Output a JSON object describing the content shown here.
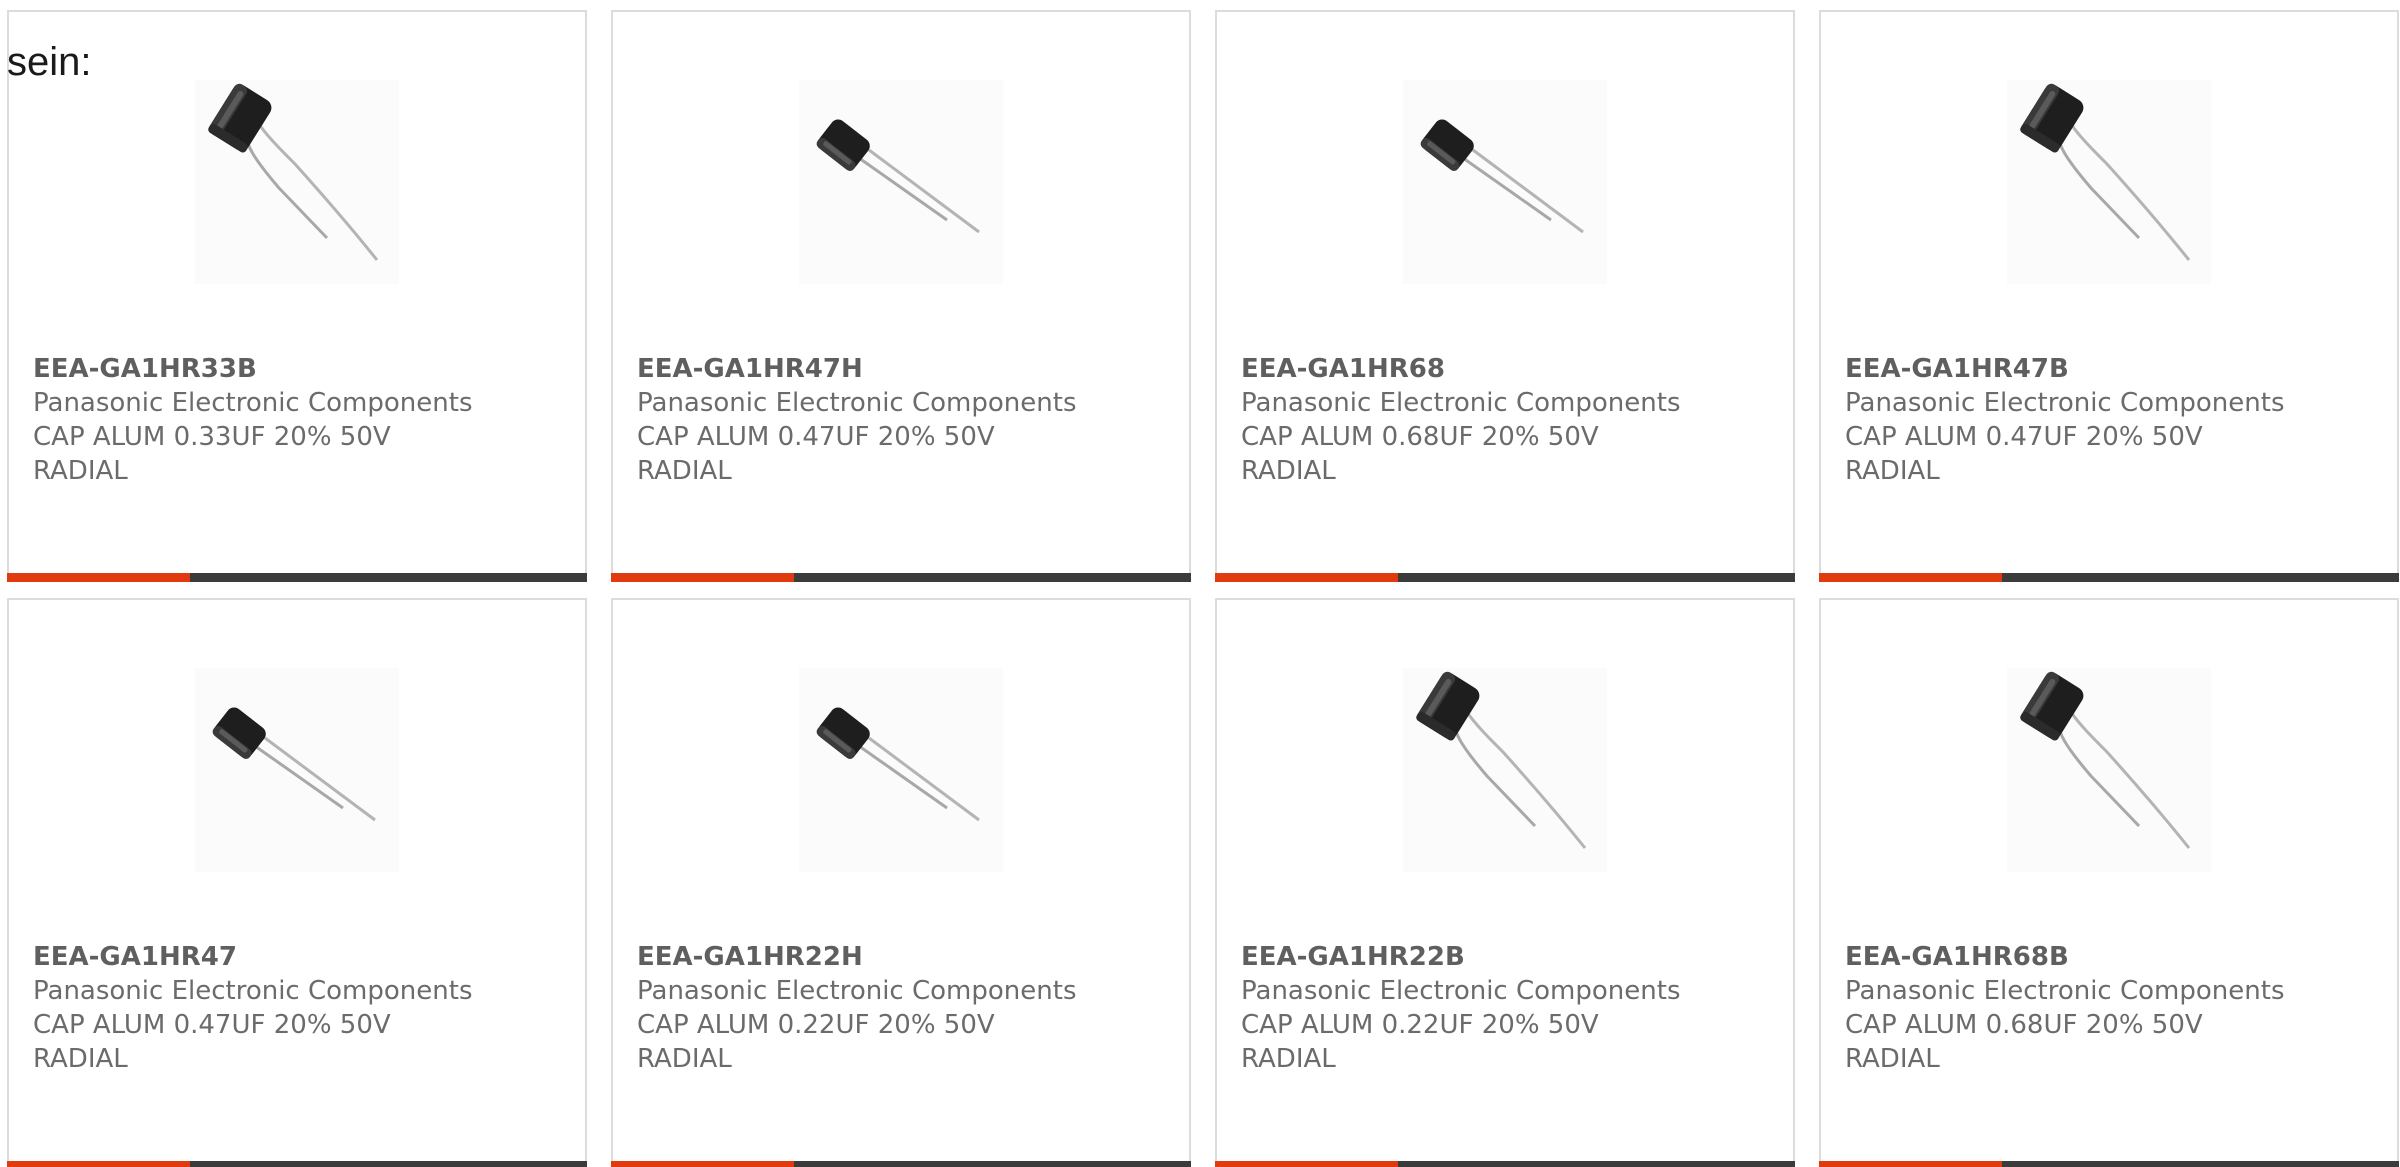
{
  "intro_text": "sein:",
  "colors": {
    "accent": "#e03a0e",
    "bar": "#3b3b3b",
    "border": "#dcdcdc",
    "text": "#6b6b6b"
  },
  "products": [
    {
      "part_number": "EEA-GA1HR33B",
      "manufacturer": "Panasonic Electronic Components",
      "description": "CAP ALUM 0.33UF 20% 50V RADIAL",
      "image_icon": "capacitor-bent-leads-image"
    },
    {
      "part_number": "EEA-GA1HR47H",
      "manufacturer": "Panasonic Electronic Components",
      "description": "CAP ALUM 0.47UF 20% 50V RADIAL",
      "image_icon": "capacitor-straight-leads-image"
    },
    {
      "part_number": "EEA-GA1HR68",
      "manufacturer": "Panasonic Electronic Components",
      "description": "CAP ALUM 0.68UF 20% 50V RADIAL",
      "image_icon": "capacitor-straight-leads-image"
    },
    {
      "part_number": "EEA-GA1HR47B",
      "manufacturer": "Panasonic Electronic Components",
      "description": "CAP ALUM 0.47UF 20% 50V RADIAL",
      "image_icon": "capacitor-bent-leads-image"
    },
    {
      "part_number": "EEA-GA1HR47",
      "manufacturer": "Panasonic Electronic Components",
      "description": "CAP ALUM 0.47UF 20% 50V RADIAL",
      "image_icon": "capacitor-straight-leads-image"
    },
    {
      "part_number": "EEA-GA1HR22H",
      "manufacturer": "Panasonic Electronic Components",
      "description": "CAP ALUM 0.22UF 20% 50V RADIAL",
      "image_icon": "capacitor-straight-leads-image"
    },
    {
      "part_number": "EEA-GA1HR22B",
      "manufacturer": "Panasonic Electronic Components",
      "description": "CAP ALUM 0.22UF 20% 50V RADIAL",
      "image_icon": "capacitor-bent-leads-image"
    },
    {
      "part_number": "EEA-GA1HR68B",
      "manufacturer": "Panasonic Electronic Components",
      "description": "CAP ALUM 0.68UF 20% 50V RADIAL",
      "image_icon": "capacitor-bent-leads-image"
    }
  ]
}
